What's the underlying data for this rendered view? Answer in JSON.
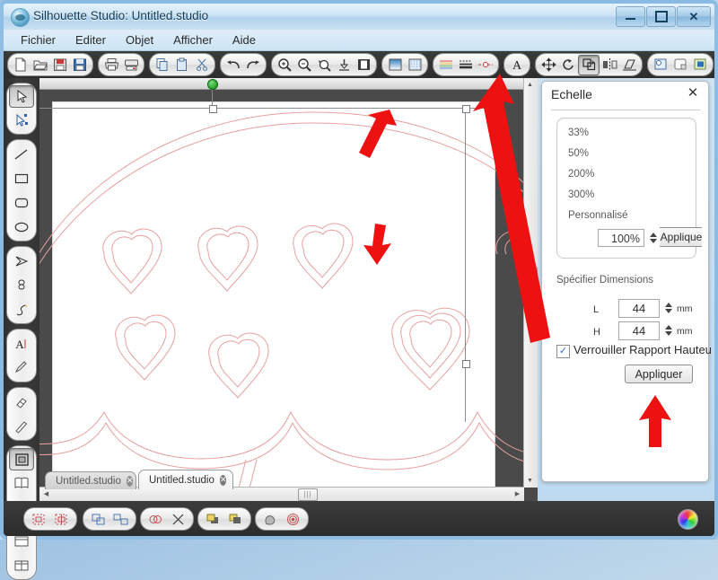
{
  "window": {
    "title": "Silhouette Studio: Untitled.studio",
    "app_icon": "silhouette-logo-icon",
    "minimize_label": "–",
    "maximize_label": "□",
    "close_label": "✕"
  },
  "menubar": {
    "items": [
      {
        "label": "Fichier",
        "name": "menu-fichier"
      },
      {
        "label": "Editer",
        "name": "menu-editer"
      },
      {
        "label": "Objet",
        "name": "menu-objet"
      },
      {
        "label": "Afficher",
        "name": "menu-afficher"
      },
      {
        "label": "Aide",
        "name": "menu-aide"
      }
    ]
  },
  "toolbar": {
    "groups": [
      {
        "icons": [
          "new-document-icon",
          "open-folder-icon",
          "save-icon",
          "save-as-icon"
        ]
      },
      {
        "icons": [
          "print-icon",
          "send-to-silhouette-icon"
        ]
      },
      {
        "icons": [
          "copy-icon",
          "paste-icon",
          "cut-scissors-icon"
        ]
      },
      {
        "icons": [
          "undo-icon",
          "redo-icon"
        ]
      },
      {
        "icons": [
          "zoom-in-icon",
          "zoom-out-icon",
          "zoom-selection-icon",
          "fit-to-page-icon",
          "page-view-icon"
        ]
      },
      {
        "icons": [
          "gradient-fill-icon",
          "pattern-fill-icon"
        ]
      },
      {
        "icons": [
          "color-palette-icon",
          "line-style-icon",
          "cut-style-icon"
        ]
      },
      {
        "icons": [
          "text-style-icon"
        ]
      },
      {
        "icons": [
          "move-transform-icon",
          "rotate-icon",
          "scale-icon",
          "mirror-icon",
          "shear-icon"
        ]
      },
      {
        "icons": [
          "align-objects-icon",
          "replicate-icon",
          "modify-icon"
        ]
      },
      {
        "icons": [
          "offset-icon",
          "trace-icon",
          "crop-icon",
          "grid-icon"
        ]
      }
    ],
    "active_icon": "scale-icon"
  },
  "left_toolbar": {
    "groups": [
      {
        "icons": [
          "select-arrow-icon",
          "edit-points-icon"
        ]
      },
      {
        "icons": [
          "line-tool-icon",
          "rectangle-tool-icon",
          "rounded-rectangle-tool-icon",
          "ellipse-tool-icon"
        ]
      },
      {
        "icons": [
          "polygon-tool-icon",
          "curve-tool-icon",
          "freehand-draw-icon"
        ]
      },
      {
        "icons": [
          "text-tool-icon",
          "note-tool-icon"
        ]
      },
      {
        "icons": [
          "eraser-tool-icon",
          "knife-tool-icon"
        ]
      },
      {
        "icons": [
          "page-setup-icon",
          "library-icon",
          "eyedropper-icon"
        ]
      },
      {
        "icons": [
          "panel-single-icon",
          "panel-split-icon"
        ]
      }
    ],
    "active_icon": "select-arrow-icon"
  },
  "canvas": {
    "artwork_name": "umbrella-with-hearts-cut-design",
    "stroke_color": "#e8a0a0",
    "selection": {
      "rotate_handle_color": "#0a8a0a",
      "handle_color": "#ffffff"
    }
  },
  "tabs": [
    {
      "label": "Untitled.studio",
      "active": false,
      "close_label": "✕"
    },
    {
      "label": "Untitled.studio",
      "active": true,
      "close_label": "✕"
    }
  ],
  "panel": {
    "title": "Echelle",
    "close_label": "✕",
    "scale_options": [
      "33%",
      "50%",
      "200%",
      "300%",
      "Personnalisé"
    ],
    "custom_percent": "100%",
    "apply_small_label": "Appliquer",
    "dimensions_title": "Spécifier Dimensions",
    "width_label": "L",
    "width_value": "44",
    "width_unit": "mm",
    "height_label": "H",
    "height_value": "44",
    "height_unit": "mm",
    "lock_ratio_label": "Verrouiller Rapport Hauteur/Largeur",
    "lock_ratio_checked": true,
    "lock_check_glyph": "✓",
    "apply_label": "Appliquer"
  },
  "bottom_toolbar": {
    "groups": [
      {
        "icons": [
          "align-left-icon",
          "align-center-icon"
        ]
      },
      {
        "icons": [
          "group-icon",
          "ungroup-icon"
        ]
      },
      {
        "icons": [
          "weld-icon",
          "subtract-icon"
        ]
      },
      {
        "icons": [
          "bring-to-front-icon",
          "send-to-back-icon"
        ]
      },
      {
        "icons": [
          "offset-shape-icon",
          "concentric-offset-icon"
        ]
      }
    ],
    "color_wheel_icon": "color-wheel-icon"
  },
  "scrollbars": {
    "up_arrow": "▲",
    "down_arrow": "▼",
    "left_arrow": "◀",
    "right_arrow": "▶",
    "grip_glyph": "≡"
  },
  "annotations": {
    "color": "#ee1111",
    "arrows": [
      {
        "name": "annotation-arrow-canvas-top",
        "points_to": "artwork-top-edge"
      },
      {
        "name": "annotation-arrow-canvas-heart",
        "points_to": "heart-shape"
      },
      {
        "name": "annotation-arrow-to-scale-tool",
        "points_to": "scale-toolbar-button"
      },
      {
        "name": "annotation-arrow-to-apply-button",
        "points_to": "appliquer-button"
      }
    ]
  }
}
